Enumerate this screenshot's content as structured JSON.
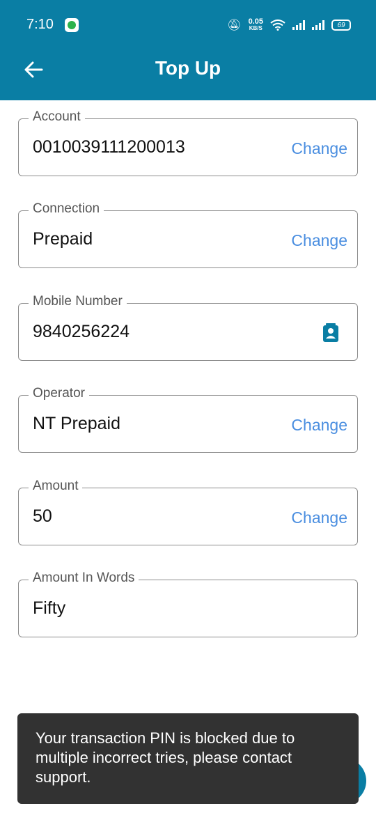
{
  "status_bar": {
    "time": "7:10",
    "net_speed_value": "0.05",
    "net_speed_unit": "KB/S",
    "battery": "69"
  },
  "header": {
    "title": "Top Up"
  },
  "fields": {
    "account": {
      "label": "Account",
      "value": "0010039111200013",
      "action": "Change"
    },
    "connection": {
      "label": "Connection",
      "value": "Prepaid",
      "action": "Change"
    },
    "mobile": {
      "label": "Mobile Number",
      "value": "9840256224",
      "icon": "contact-icon"
    },
    "operator": {
      "label": "Operator",
      "value": "NT Prepaid",
      "action": "Change"
    },
    "amount": {
      "label": "Amount",
      "value": "50",
      "action": "Change"
    },
    "amount_words": {
      "label": "Amount In Words",
      "value": "Fifty"
    }
  },
  "toast": {
    "message": "Your transaction PIN is blocked due to multiple incorrect tries, please contact support."
  },
  "colors": {
    "header": "#0a7ea4",
    "link": "#4a8ee0",
    "toast": "#323232"
  }
}
